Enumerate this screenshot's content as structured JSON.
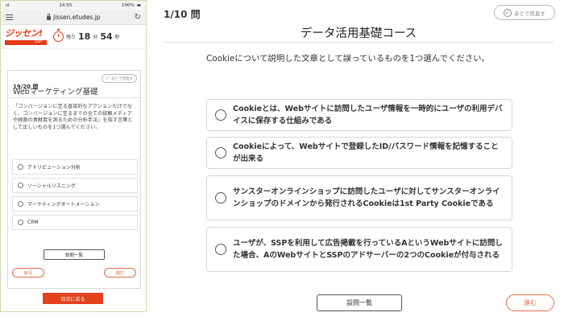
{
  "mobile": {
    "status_bar": {
      "carrier": "ııl",
      "time": "14:55",
      "battery": "100%"
    },
    "url": "jissen.etudes.jp",
    "logo": {
      "main": "ジッセン!",
      "sub": "SOP"
    },
    "timer": {
      "label": "残り",
      "minutes": "18",
      "minutes_unit": "分",
      "seconds": "54",
      "seconds_unit": "秒"
    },
    "card": {
      "count": "19/20 問",
      "later_label": "あとで見直す",
      "title": "Webマーケティング基礎",
      "question": "「コンバージョンに至る直接的なアクションだけでなく、コンバージョンに至るまでの全ての接触メディアや経路の貢献度を測るための分析手法」を指す言葉として正しいものを1つ選んでください。",
      "choices": [
        {
          "label": "アトリビューション分析"
        },
        {
          "label": "ソーシャルリスニング"
        },
        {
          "label": "マーケティングオートメーション"
        },
        {
          "label": "CRM"
        }
      ],
      "list_button": "設問一覧",
      "back_button": "戻る",
      "next_button": "進む"
    },
    "toc_button": "目次に戻る"
  },
  "desktop": {
    "counter": "1/10 問",
    "later_label": "あとで見直す",
    "course_title": "データ活用基礎コース",
    "question": "Cookieについて説明した文章として誤っているものを1つ選んでください。",
    "choices": [
      {
        "label": "Cookieとは、Webサイトに訪問したユーザ情報を一時的にユーザの利用デバイスに保存する仕組みである"
      },
      {
        "label": "Cookieによって、Webサイトで登録したID/パスワード情報を記憶することが出来る"
      },
      {
        "label": "サンスターオンラインショップに訪問したユーザに対してサンスターオンラインショップのドメインから発行されるCookieは1st Party Cookieである"
      },
      {
        "label": "ユーザが、SSPを利用して広告掲載を行っているAというWebサイトに訪問した場合、AのWebサイトとSSPのアドサーバーの2つのCookieが付与される"
      }
    ],
    "list_button": "設問一覧",
    "next_button": "進む"
  },
  "colors": {
    "accent": "#e36a4a",
    "brand_red": "#e53a16",
    "border": "#d6d6d6"
  }
}
